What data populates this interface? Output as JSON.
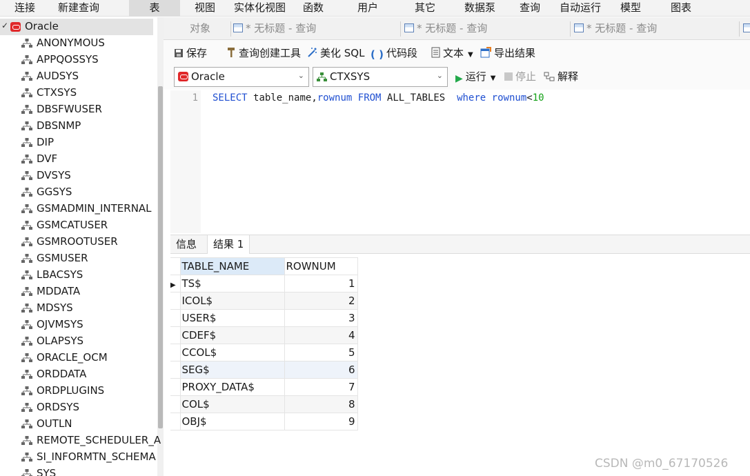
{
  "menu": [
    "连接",
    "新建查询",
    "表",
    "视图",
    "实体化视图",
    "函数",
    "用户",
    "其它",
    "数据泵",
    "查询",
    "自动运行",
    "模型",
    "图表"
  ],
  "sidebar": {
    "connection": "Oracle",
    "schemas": [
      "ANONYMOUS",
      "APPQOSSYS",
      "AUDSYS",
      "CTXSYS",
      "DBSFWUSER",
      "DBSNMP",
      "DIP",
      "DVF",
      "DVSYS",
      "GGSYS",
      "GSMADMIN_INTERNAL",
      "GSMCATUSER",
      "GSMROOTUSER",
      "GSMUSER",
      "LBACSYS",
      "MDDATA",
      "MDSYS",
      "OJVMSYS",
      "OLAPSYS",
      "ORACLE_OCM",
      "ORDDATA",
      "ORDPLUGINS",
      "ORDSYS",
      "OUTLN",
      "REMOTE_SCHEDULER_A",
      "SI_INFORMTN_SCHEMA",
      "SYS"
    ]
  },
  "tabs": {
    "objects": "对象",
    "query_tabs": [
      "* 无标题 - 查询",
      "* 无标题 - 查询",
      "* 无标题 - 查询"
    ]
  },
  "toolbar": {
    "save": "保存",
    "query_builder": "查询创建工具",
    "beautify": "美化 SQL",
    "snippet": "代码段",
    "text": "文本",
    "export": "导出结果"
  },
  "selectors": {
    "connection": "Oracle",
    "schema": "CTXSYS",
    "run": "运行",
    "stop": "停止",
    "explain": "解释"
  },
  "editor": {
    "line_number": "1",
    "sql": "SELECT table_name,rownum FROM ALL_TABLES  where rownum<10"
  },
  "results": {
    "tab_info": "信息",
    "tab_result": "结果 1",
    "columns": [
      "TABLE_NAME",
      "ROWNUM"
    ],
    "rows": [
      [
        "TS$",
        "1"
      ],
      [
        "ICOL$",
        "2"
      ],
      [
        "USER$",
        "3"
      ],
      [
        "CDEF$",
        "4"
      ],
      [
        "CCOL$",
        "5"
      ],
      [
        "SEG$",
        "6"
      ],
      [
        "PROXY_DATA$",
        "7"
      ],
      [
        "COL$",
        "8"
      ],
      [
        "OBJ$",
        "9"
      ]
    ]
  },
  "watermark": "CSDN @m0_67170526",
  "colors": {
    "oracle_red": "#e0282a",
    "keyword_blue": "#1f4fd1",
    "number_green": "#13a016",
    "run_green": "#22a84a"
  }
}
